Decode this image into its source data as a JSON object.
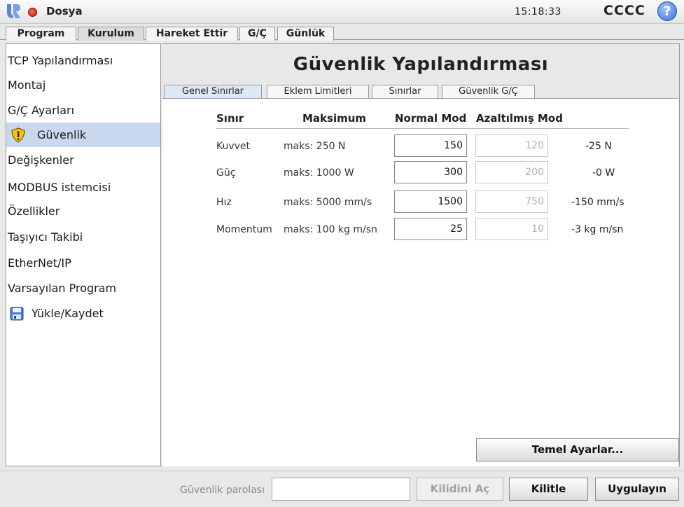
{
  "topbar": {
    "file_menu": "Dosya",
    "time": "15:18:33",
    "robot_name": "CCCC",
    "help": "?"
  },
  "main_tabs": [
    "Program",
    "Kurulum",
    "Hareket Ettir",
    "G/Ç",
    "Günlük"
  ],
  "sidebar": {
    "items": [
      {
        "label": "TCP Yapılandırması"
      },
      {
        "label": "Montaj"
      },
      {
        "label": "G/Ç Ayarları"
      },
      {
        "label": "Güvenlik",
        "icon": "warning-shield-icon",
        "selected": true
      },
      {
        "label": "Değişkenler"
      },
      {
        "label": "MODBUS istemcisi"
      },
      {
        "label": "Özellikler"
      },
      {
        "label": "Taşıyıcı Takibi"
      },
      {
        "label": "EtherNet/IP"
      },
      {
        "label": "Varsayılan Program"
      },
      {
        "label": "Yükle/Kaydet",
        "icon": "save-disk-icon"
      }
    ]
  },
  "content": {
    "title": "Güvenlik Yapılandırması",
    "sub_tabs": [
      "Genel Sınırlar",
      "Eklem Limitleri",
      "Sınırlar",
      "Güvenlik G/Ç"
    ],
    "columns": {
      "limit": "Sınır",
      "max": "Maksimum",
      "normal": "Normal Mod",
      "reduced": "Azaltılmış Mod"
    },
    "rows": [
      {
        "name": "Kuvvet",
        "max": "maks: 250 N",
        "normal": "150",
        "reduced": "120",
        "delta": "-25 N"
      },
      {
        "name": "Güç",
        "max": "maks: 1000 W",
        "normal": "300",
        "reduced": "200",
        "delta": "-0 W"
      },
      {
        "name": "Hız",
        "max": "maks: 5000 mm/s",
        "normal": "1500",
        "reduced": "750",
        "delta": "-150 mm/s"
      },
      {
        "name": "Momentum",
        "max": "maks: 100 kg m/sn",
        "normal": "25",
        "reduced": "10",
        "delta": "-3 kg m/sn"
      }
    ],
    "basic_settings_button": "Temel Ayarlar..."
  },
  "footer": {
    "password_label": "Güvenlik parolası",
    "password_value": "",
    "unlock_button": "Kilidini Aç",
    "lock_button": "Kilitle",
    "apply_button": "Uygulayın"
  },
  "colors": {
    "selected_row": "#cad8ef",
    "active_subtab": "#dfe8f6",
    "status_dot": "#e0241a"
  }
}
